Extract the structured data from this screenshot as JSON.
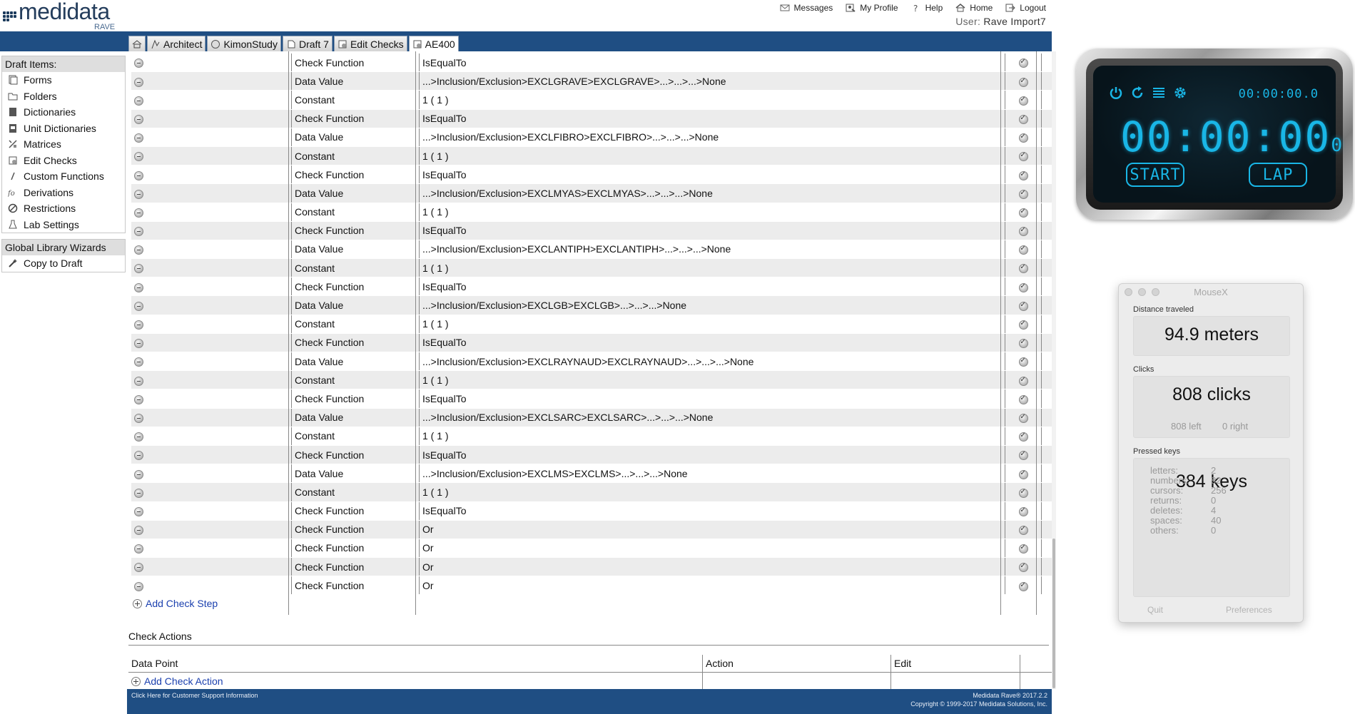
{
  "app": {
    "logo": "medidata",
    "logo_sub": "RAVE",
    "top_links": [
      {
        "label": "Messages",
        "icon": "envelope-icon"
      },
      {
        "label": "My Profile",
        "icon": "profile-icon"
      },
      {
        "label": "Help",
        "icon": "help-icon"
      },
      {
        "label": "Home",
        "icon": "home-icon"
      },
      {
        "label": "Logout",
        "icon": "logout-icon"
      }
    ],
    "user_label": "User:",
    "user_name": "Rave Import7",
    "tabs": [
      {
        "label": "",
        "icon": "home-icon"
      },
      {
        "label": "Architect",
        "icon": "architect-icon"
      },
      {
        "label": "KimonStudy",
        "icon": "study-icon"
      },
      {
        "label": "Draft 7",
        "icon": "draft-icon"
      },
      {
        "label": "Edit Checks",
        "icon": "edit-checks-icon"
      },
      {
        "label": "AE400",
        "icon": "check-icon"
      }
    ]
  },
  "sidebar": {
    "draft_title": "Draft Items:",
    "draft_items": [
      {
        "label": "Forms",
        "icon": "forms-icon"
      },
      {
        "label": "Folders",
        "icon": "folder-icon"
      },
      {
        "label": "Dictionaries",
        "icon": "dictionary-icon"
      },
      {
        "label": "Unit Dictionaries",
        "icon": "unit-dictionary-icon"
      },
      {
        "label": "Matrices",
        "icon": "matrix-icon"
      },
      {
        "label": "Edit Checks",
        "icon": "edit-checks-icon"
      },
      {
        "label": "Custom Functions",
        "icon": "custom-function-icon"
      },
      {
        "label": "Derivations",
        "icon": "derivation-icon"
      },
      {
        "label": "Restrictions",
        "icon": "restriction-icon"
      },
      {
        "label": "Lab Settings",
        "icon": "lab-icon"
      }
    ],
    "library_title": "Global Library Wizards",
    "library_items": [
      {
        "label": "Copy to Draft",
        "icon": "wand-icon"
      }
    ]
  },
  "steps": [
    {
      "type": "Check Function",
      "value": "IsEqualTo"
    },
    {
      "type": "Data Value",
      "value": "...>Inclusion/Exclusion>EXCLGRAVE>EXCLGRAVE>...>...>...>None"
    },
    {
      "type": "Constant",
      "value": "1 ( 1 )"
    },
    {
      "type": "Check Function",
      "value": "IsEqualTo"
    },
    {
      "type": "Data Value",
      "value": "...>Inclusion/Exclusion>EXCLFIBRO>EXCLFIBRO>...>...>...>None"
    },
    {
      "type": "Constant",
      "value": "1 ( 1 )"
    },
    {
      "type": "Check Function",
      "value": "IsEqualTo"
    },
    {
      "type": "Data Value",
      "value": "...>Inclusion/Exclusion>EXCLMYAS>EXCLMYAS>...>...>...>None"
    },
    {
      "type": "Constant",
      "value": "1 ( 1 )"
    },
    {
      "type": "Check Function",
      "value": "IsEqualTo"
    },
    {
      "type": "Data Value",
      "value": "...>Inclusion/Exclusion>EXCLANTIPH>EXCLANTIPH>...>...>...>None"
    },
    {
      "type": "Constant",
      "value": "1 ( 1 )"
    },
    {
      "type": "Check Function",
      "value": "IsEqualTo"
    },
    {
      "type": "Data Value",
      "value": "...>Inclusion/Exclusion>EXCLGB>EXCLGB>...>...>...>None"
    },
    {
      "type": "Constant",
      "value": "1 ( 1 )"
    },
    {
      "type": "Check Function",
      "value": "IsEqualTo"
    },
    {
      "type": "Data Value",
      "value": "...>Inclusion/Exclusion>EXCLRAYNAUD>EXCLRAYNAUD>...>...>...>None"
    },
    {
      "type": "Constant",
      "value": "1 ( 1 )"
    },
    {
      "type": "Check Function",
      "value": "IsEqualTo"
    },
    {
      "type": "Data Value",
      "value": "...>Inclusion/Exclusion>EXCLSARC>EXCLSARC>...>...>...>None"
    },
    {
      "type": "Constant",
      "value": "1 ( 1 )"
    },
    {
      "type": "Check Function",
      "value": "IsEqualTo"
    },
    {
      "type": "Data Value",
      "value": "...>Inclusion/Exclusion>EXCLMS>EXCLMS>...>...>...>None"
    },
    {
      "type": "Constant",
      "value": "1 ( 1 )"
    },
    {
      "type": "Check Function",
      "value": "IsEqualTo"
    },
    {
      "type": "Check Function",
      "value": "Or"
    },
    {
      "type": "Check Function",
      "value": "Or"
    },
    {
      "type": "Check Function",
      "value": "Or"
    },
    {
      "type": "Check Function",
      "value": "Or"
    }
  ],
  "add_check_step": "Add Check Step",
  "actions": {
    "title": "Check Actions",
    "headers": [
      "Data Point",
      "Action",
      "Edit",
      ""
    ],
    "add_label": "Add Check Action"
  },
  "footer": {
    "support": "Click Here for Customer Support Information",
    "version": "Medidata Rave® 2017.2.2",
    "copyright": "Copyright © 1999-2017 Medidata Solutions, Inc."
  },
  "stopwatch": {
    "small_time": "00:00:00.0",
    "big_time": "00:00:00",
    "big_tenths": "0",
    "start": "START",
    "lap": "LAP",
    "icons": [
      "power-icon",
      "reset-icon",
      "list-icon",
      "settings-icon"
    ],
    "color": "#19b6e6"
  },
  "mousex": {
    "title": "MouseX",
    "distance_label": "Distance traveled",
    "distance_value": "94.9 meters",
    "clicks_label": "Clicks",
    "clicks_value": "808 clicks",
    "clicks_left": "808 left",
    "clicks_right": "0 right",
    "keys_label": "Pressed keys",
    "keys_value": "384 keys",
    "key_rows": [
      {
        "label": "letters:",
        "value": "2"
      },
      {
        "label": "numbers:",
        "value": "82"
      },
      {
        "label": "cursors:",
        "value": "256"
      },
      {
        "label": "returns:",
        "value": "0"
      },
      {
        "label": "deletes:",
        "value": "4"
      },
      {
        "label": "spaces:",
        "value": "40"
      },
      {
        "label": "others:",
        "value": "0"
      }
    ],
    "quit": "Quit",
    "preferences": "Preferences"
  },
  "colors": {
    "brand_blue": "#1f4e83",
    "link_blue": "#1a3fae"
  }
}
